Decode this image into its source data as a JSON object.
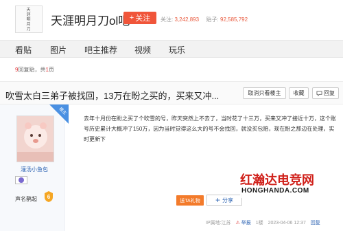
{
  "header": {
    "forum_name": "天涯明月刀ol吧",
    "logo_text": [
      "天",
      "涯",
      "明",
      "月",
      "刀"
    ],
    "follow_label": "关注",
    "follow_icon": "plus-icon",
    "followers_label": "关注:",
    "followers_count": "3,242,893",
    "posts_label": "贴子:",
    "posts_count": "92,585,792"
  },
  "nav": {
    "tabs": [
      {
        "label": "看贴"
      },
      {
        "label": "图片"
      },
      {
        "label": "吧主推荐"
      },
      {
        "label": "视频"
      },
      {
        "label": "玩乐"
      }
    ]
  },
  "reply_bar": {
    "count": "9",
    "count_suffix": "回复贴，共",
    "pages": "1",
    "pages_suffix": "页"
  },
  "thread": {
    "title": "吹雪太白三弟子被找回，13万在盼之买的，买来又冲...",
    "buttons": {
      "only_op": "取消只看楼主",
      "favorite": "收藏",
      "reply": "回复"
    }
  },
  "post": {
    "op_badge": "楼主",
    "author_name": "灌汤小鱼包",
    "badge_label": "声名鹊起",
    "badge_level": "6",
    "content": "去年十月份在盼之买了个吹雪的号，昨天突然上不去了，当时花了十三万，买来又冲了接近十万，这个账号历史累计大概冲了150万，因为当时觉得这么大的号不会找回，就没买包赔，现在盼之那边在处理，实时更新下",
    "gift_label": "送TA礼物",
    "share_label": "分享",
    "meta": {
      "ip_location": "IP属地:江苏",
      "report": "举报",
      "floor": "1楼",
      "datetime": "2023-04-06 12:37",
      "reply": "回复"
    }
  },
  "watermark": {
    "title": "红瀚达电竞网",
    "url": "HONGHANDA.COM"
  },
  "colors": {
    "accent": "#f0553a",
    "link": "#2d64b3",
    "number": "#e95b3f",
    "gift": "#f37b2b",
    "watermark_red": "#d0201a"
  }
}
